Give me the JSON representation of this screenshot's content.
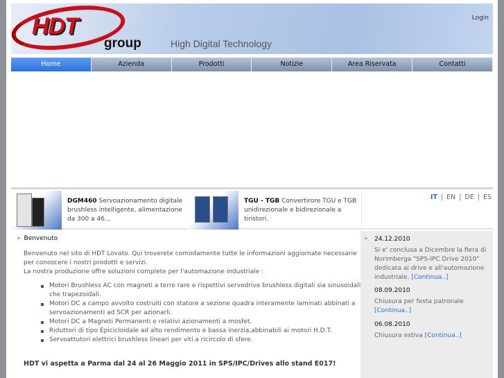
{
  "header": {
    "logo_text": "HDT",
    "logo_group": "group",
    "tagline": "High Digital Technology",
    "login": "Login"
  },
  "nav": [
    "Home",
    "Azienda",
    "Prodotti",
    "Notizie",
    "Area Riservata",
    "Contatti"
  ],
  "products": [
    {
      "title": "DGM460",
      "text": "Servoazionamento digitale brushless intelligente, alimentazione da 300 a 46..."
    },
    {
      "title": "TGU - TGB",
      "text": "Convertirore TGU e TGB unidirezionale e bidirezionale a tiristori."
    }
  ],
  "languages": [
    "IT",
    "EN",
    "DE",
    "ES"
  ],
  "main": {
    "heading": "Benvenuto",
    "intro1": "Benvenuto nel sito di HDT Lovato. Qui troverete comodamente tutte le informazioni aggiornate necessarie per conoscere i nostri prodotti e servizi.",
    "intro2": "La nostra produzione offre soluzioni complete per l'automazione industriale :",
    "items": [
      "Motori Brushless AC con magneti a terre rare e rispettivi servodrive brushless digitali sia sinusoidali che trapezoidali.",
      "Motori DC  a campo avvolto costruiti con statore a sezione quadra interamente laminati abbinati a servoazionamenti ad SCR per azionarli.",
      "Motori DC a Magneti Permanenti  e  relativi azionamenti a mosfet.",
      "Riduttori di tipo Epicicloidale ad alto rendimento e bassa inerzia,abbinabili  ai motori H.D.T.",
      "Servoattutori elettrici brushless lineari per viti a ricircolo di sfere."
    ],
    "announcement": "HDT vi aspetta a Parma dal 24 al 26 Maggio 2011 in SPS/IPC/Drives allo stand  E017!"
  },
  "news": [
    {
      "date": "24.12.2010",
      "text": "Si e' conclusa a Dicembre la fiera di Norimberga \"SPS-IPC Drive 2010\" dedicata ai drive e all'automazione industriale.",
      "link": "[Continua..]"
    },
    {
      "date": "08.09.2010",
      "text": "Chiusura per festa patronale",
      "link": "[Continua..]"
    },
    {
      "date": "06.08.2010",
      "text": "Chiusura estiva",
      "link": "[Continua..]"
    }
  ]
}
